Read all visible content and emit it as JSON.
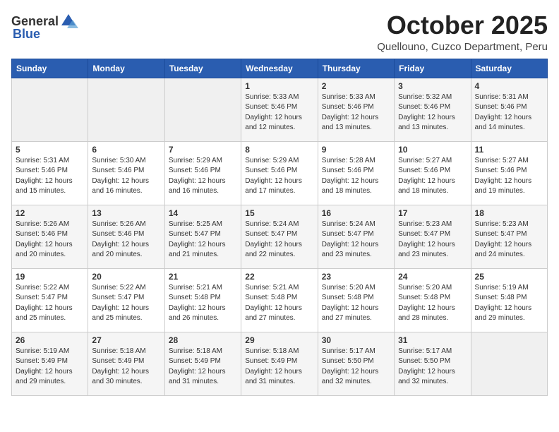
{
  "logo": {
    "general": "General",
    "blue": "Blue"
  },
  "header": {
    "title": "October 2025",
    "subtitle": "Quellouno, Cuzco Department, Peru"
  },
  "weekdays": [
    "Sunday",
    "Monday",
    "Tuesday",
    "Wednesday",
    "Thursday",
    "Friday",
    "Saturday"
  ],
  "weeks": [
    [
      {
        "day": "",
        "info": ""
      },
      {
        "day": "",
        "info": ""
      },
      {
        "day": "",
        "info": ""
      },
      {
        "day": "1",
        "info": "Sunrise: 5:33 AM\nSunset: 5:46 PM\nDaylight: 12 hours\nand 12 minutes."
      },
      {
        "day": "2",
        "info": "Sunrise: 5:33 AM\nSunset: 5:46 PM\nDaylight: 12 hours\nand 13 minutes."
      },
      {
        "day": "3",
        "info": "Sunrise: 5:32 AM\nSunset: 5:46 PM\nDaylight: 12 hours\nand 13 minutes."
      },
      {
        "day": "4",
        "info": "Sunrise: 5:31 AM\nSunset: 5:46 PM\nDaylight: 12 hours\nand 14 minutes."
      }
    ],
    [
      {
        "day": "5",
        "info": "Sunrise: 5:31 AM\nSunset: 5:46 PM\nDaylight: 12 hours\nand 15 minutes."
      },
      {
        "day": "6",
        "info": "Sunrise: 5:30 AM\nSunset: 5:46 PM\nDaylight: 12 hours\nand 16 minutes."
      },
      {
        "day": "7",
        "info": "Sunrise: 5:29 AM\nSunset: 5:46 PM\nDaylight: 12 hours\nand 16 minutes."
      },
      {
        "day": "8",
        "info": "Sunrise: 5:29 AM\nSunset: 5:46 PM\nDaylight: 12 hours\nand 17 minutes."
      },
      {
        "day": "9",
        "info": "Sunrise: 5:28 AM\nSunset: 5:46 PM\nDaylight: 12 hours\nand 18 minutes."
      },
      {
        "day": "10",
        "info": "Sunrise: 5:27 AM\nSunset: 5:46 PM\nDaylight: 12 hours\nand 18 minutes."
      },
      {
        "day": "11",
        "info": "Sunrise: 5:27 AM\nSunset: 5:46 PM\nDaylight: 12 hours\nand 19 minutes."
      }
    ],
    [
      {
        "day": "12",
        "info": "Sunrise: 5:26 AM\nSunset: 5:46 PM\nDaylight: 12 hours\nand 20 minutes."
      },
      {
        "day": "13",
        "info": "Sunrise: 5:26 AM\nSunset: 5:46 PM\nDaylight: 12 hours\nand 20 minutes."
      },
      {
        "day": "14",
        "info": "Sunrise: 5:25 AM\nSunset: 5:47 PM\nDaylight: 12 hours\nand 21 minutes."
      },
      {
        "day": "15",
        "info": "Sunrise: 5:24 AM\nSunset: 5:47 PM\nDaylight: 12 hours\nand 22 minutes."
      },
      {
        "day": "16",
        "info": "Sunrise: 5:24 AM\nSunset: 5:47 PM\nDaylight: 12 hours\nand 23 minutes."
      },
      {
        "day": "17",
        "info": "Sunrise: 5:23 AM\nSunset: 5:47 PM\nDaylight: 12 hours\nand 23 minutes."
      },
      {
        "day": "18",
        "info": "Sunrise: 5:23 AM\nSunset: 5:47 PM\nDaylight: 12 hours\nand 24 minutes."
      }
    ],
    [
      {
        "day": "19",
        "info": "Sunrise: 5:22 AM\nSunset: 5:47 PM\nDaylight: 12 hours\nand 25 minutes."
      },
      {
        "day": "20",
        "info": "Sunrise: 5:22 AM\nSunset: 5:47 PM\nDaylight: 12 hours\nand 25 minutes."
      },
      {
        "day": "21",
        "info": "Sunrise: 5:21 AM\nSunset: 5:48 PM\nDaylight: 12 hours\nand 26 minutes."
      },
      {
        "day": "22",
        "info": "Sunrise: 5:21 AM\nSunset: 5:48 PM\nDaylight: 12 hours\nand 27 minutes."
      },
      {
        "day": "23",
        "info": "Sunrise: 5:20 AM\nSunset: 5:48 PM\nDaylight: 12 hours\nand 27 minutes."
      },
      {
        "day": "24",
        "info": "Sunrise: 5:20 AM\nSunset: 5:48 PM\nDaylight: 12 hours\nand 28 minutes."
      },
      {
        "day": "25",
        "info": "Sunrise: 5:19 AM\nSunset: 5:48 PM\nDaylight: 12 hours\nand 29 minutes."
      }
    ],
    [
      {
        "day": "26",
        "info": "Sunrise: 5:19 AM\nSunset: 5:49 PM\nDaylight: 12 hours\nand 29 minutes."
      },
      {
        "day": "27",
        "info": "Sunrise: 5:18 AM\nSunset: 5:49 PM\nDaylight: 12 hours\nand 30 minutes."
      },
      {
        "day": "28",
        "info": "Sunrise: 5:18 AM\nSunset: 5:49 PM\nDaylight: 12 hours\nand 31 minutes."
      },
      {
        "day": "29",
        "info": "Sunrise: 5:18 AM\nSunset: 5:49 PM\nDaylight: 12 hours\nand 31 minutes."
      },
      {
        "day": "30",
        "info": "Sunrise: 5:17 AM\nSunset: 5:50 PM\nDaylight: 12 hours\nand 32 minutes."
      },
      {
        "day": "31",
        "info": "Sunrise: 5:17 AM\nSunset: 5:50 PM\nDaylight: 12 hours\nand 32 minutes."
      },
      {
        "day": "",
        "info": ""
      }
    ]
  ]
}
